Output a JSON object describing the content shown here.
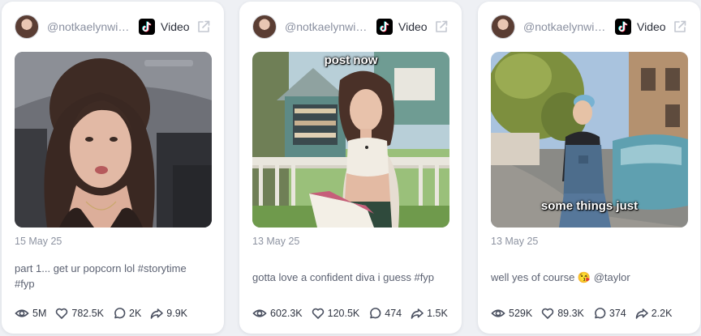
{
  "posts": [
    {
      "username": "@notkaelynwil...",
      "platform": "Video",
      "date": "15 May 25",
      "caption": "part 1... get ur popcorn lol #storytime #fyp",
      "overlay_text": "",
      "stats": {
        "views": "5M",
        "likes": "782.5K",
        "comments": "2K",
        "shares": "9.9K"
      }
    },
    {
      "username": "@notkaelynwil...",
      "platform": "Video",
      "date": "13 May 25",
      "caption": "gotta love a confident diva i guess #fyp",
      "overlay_text": "post now",
      "stats": {
        "views": "602.3K",
        "likes": "120.5K",
        "comments": "474",
        "shares": "1.5K"
      }
    },
    {
      "username": "@notkaelynwil...",
      "platform": "Video",
      "date": "13 May 25",
      "caption": "well yes of course 😘 @taylor",
      "overlay_text": "some things just",
      "stats": {
        "views": "529K",
        "likes": "89.3K",
        "comments": "374",
        "shares": "2.2K"
      }
    }
  ],
  "icons": {
    "platform": "tiktok-icon",
    "open": "external-link-icon",
    "views": "eye-icon",
    "likes": "heart-icon",
    "comments": "comment-icon",
    "shares": "share-icon"
  },
  "colors": {
    "page_background": "#eef0f4",
    "card": "#ffffff",
    "muted_text": "#8a90a0",
    "stat_text": "#2f3441"
  }
}
